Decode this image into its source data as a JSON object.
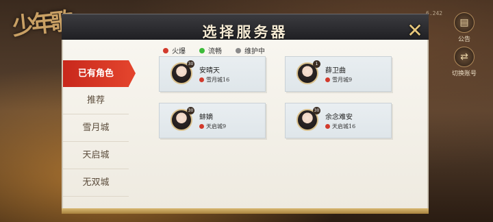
{
  "dialog": {
    "title": "选择服务器",
    "close_symbol": "✕"
  },
  "legend": [
    {
      "label": "火爆",
      "color": "#d23a2c"
    },
    {
      "label": "流畅",
      "color": "#3dbb3a"
    },
    {
      "label": "维护中",
      "color": "#8a8a8a"
    }
  ],
  "tabs": [
    "已有角色",
    "推荐",
    "雪月城",
    "天启城",
    "无双城"
  ],
  "characters": [
    {
      "name": "安晴天",
      "server": "雪月城16",
      "level": "30",
      "status_color": "#d23a2c"
    },
    {
      "name": "薛卫曲",
      "server": "雪月城9",
      "level": "1",
      "status_color": "#d23a2c"
    },
    {
      "name": "蚌嫡",
      "server": "天启城9",
      "level": "30",
      "status_color": "#d23a2c"
    },
    {
      "name": "余念难安",
      "server": "天启城16",
      "level": "30",
      "status_color": "#d23a2c"
    }
  ],
  "side": {
    "notice_label": "公告",
    "switch_label": "切换账号",
    "version": "6.242"
  },
  "logo_text": "少年歌"
}
